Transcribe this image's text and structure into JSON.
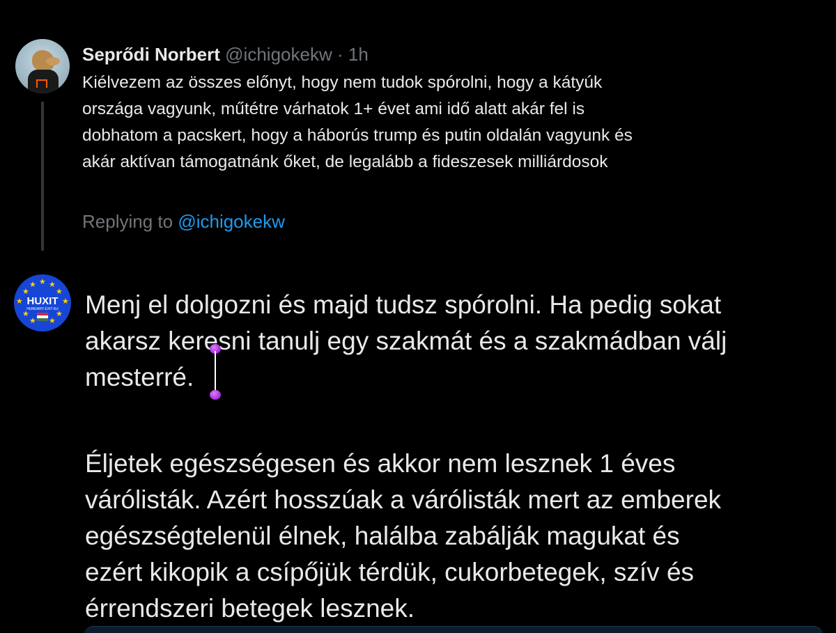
{
  "parent_tweet": {
    "display_name": "Seprődi Norbert",
    "handle": "@ichigokekw",
    "separator": "·",
    "time": "1h",
    "text_lines": [
      "Kiélvezem az összes előnyt, hogy nem tudok spórolni, hogy a kátyúk",
      "országa vagyunk, műtétre várhatok 1+ évet ami idő alatt akár fel is",
      "dobhatom a pacskert, hogy a háborús trump és putin oldalán vagyunk és",
      "akár aktívan támogatnánk őket, de legalább a fideszesek milliárdosok"
    ],
    "replying_prefix": "Replying to ",
    "replying_mention": "@ichigokekw"
  },
  "reply_avatar": {
    "label": "HUXIT",
    "sublabel": "HUNGARY EXIT EU"
  },
  "reply": {
    "paragraph1": [
      "Menj el dolgozni és majd tudsz spórolni. Ha pedig sokat",
      "akarsz keresni tanulj egy szakmát és a szakmádban válj",
      "mesterré."
    ],
    "paragraph2": [
      "Éljetek egészségesen és akkor nem lesznek 1 éves",
      "várólisták. Azért hosszúak a várólisták mert az emberek",
      "egészségtelenül élnek, halálba zabálják magukat és",
      "ezért kikopik a csípőjük térdük, cukorbetegek, szív és",
      "érrendszeri betegek lesznek."
    ]
  },
  "colors": {
    "background": "#000000",
    "text_primary": "#e7e9ea",
    "text_secondary": "#71767b",
    "link": "#1d9bf0",
    "selection_handle": "#a12bd6"
  }
}
